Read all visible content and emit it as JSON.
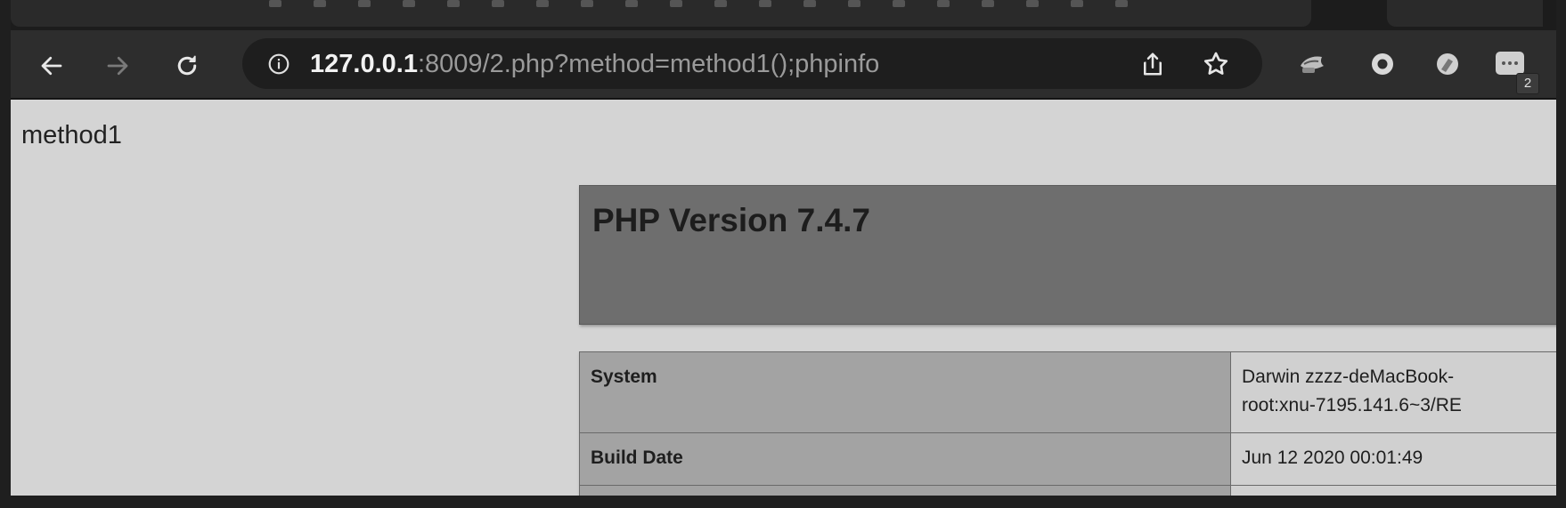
{
  "browser": {
    "address": {
      "host": "127.0.0.1",
      "rest": ":8009/2.php?method=method1();phpinfo"
    },
    "extensions": [
      {
        "icon": "extension-puzzle-icon"
      },
      {
        "icon": "circle-extension-icon"
      },
      {
        "icon": "compass-extension-icon"
      },
      {
        "icon": "chat-extension-icon",
        "badge": "2"
      }
    ]
  },
  "page": {
    "output_text": "method1",
    "phpinfo": {
      "title": "PHP Version 7.4.7",
      "rows": [
        {
          "key": "System",
          "value_line1": "Darwin zzzz-deMacBook-",
          "value_line2": "root:xnu-7195.141.6~3/RE"
        },
        {
          "key": "Build Date",
          "value_line1": "Jun 12 2020 00:01:49"
        }
      ]
    }
  }
}
